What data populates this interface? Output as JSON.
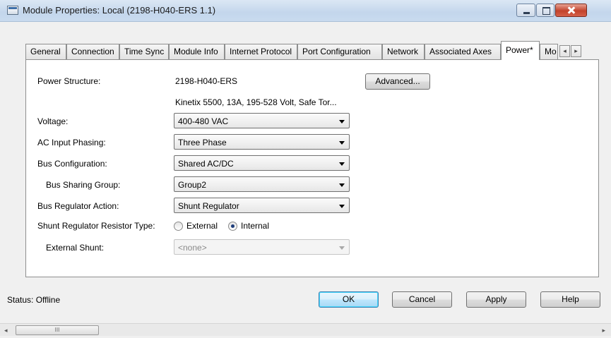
{
  "window": {
    "title": "Module Properties: Local (2198-H040-ERS 1.1)"
  },
  "tabs": [
    {
      "label": "General"
    },
    {
      "label": "Connection"
    },
    {
      "label": "Time Sync"
    },
    {
      "label": "Module Info"
    },
    {
      "label": "Internet Protocol"
    },
    {
      "label": "Port Configuration"
    },
    {
      "label": "Network"
    },
    {
      "label": "Associated Axes"
    },
    {
      "label": "Power*"
    },
    {
      "label": "Mo"
    }
  ],
  "tab_scroll": {
    "left": "◂",
    "right": "▸"
  },
  "power": {
    "power_structure_label": "Power Structure:",
    "power_structure_value": "2198-H040-ERS",
    "power_structure_desc": "Kinetix 5500, 13A, 195-528 Volt, Safe Tor...",
    "advanced_button": "Advanced...",
    "voltage_label": "Voltage:",
    "voltage_value": "400-480 VAC",
    "ac_input_label": "AC Input Phasing:",
    "ac_input_value": "Three Phase",
    "bus_config_label": "Bus Configuration:",
    "bus_config_value": "Shared AC/DC",
    "bus_sharing_label": "Bus Sharing Group:",
    "bus_sharing_value": "Group2",
    "bus_regulator_label": "Bus Regulator Action:",
    "bus_regulator_value": "Shunt Regulator",
    "shunt_type_label": "Shunt Regulator Resistor Type:",
    "shunt_external_label": "External",
    "shunt_internal_label": "Internal",
    "shunt_selected": "Internal",
    "external_shunt_label": "External Shunt:",
    "external_shunt_value": "<none>"
  },
  "footer": {
    "status": "Status:  Offline",
    "ok": "OK",
    "cancel": "Cancel",
    "apply": "Apply",
    "help": "Help"
  },
  "scrollbar": {
    "left": "◂",
    "right": "▸",
    "grip": "III"
  }
}
